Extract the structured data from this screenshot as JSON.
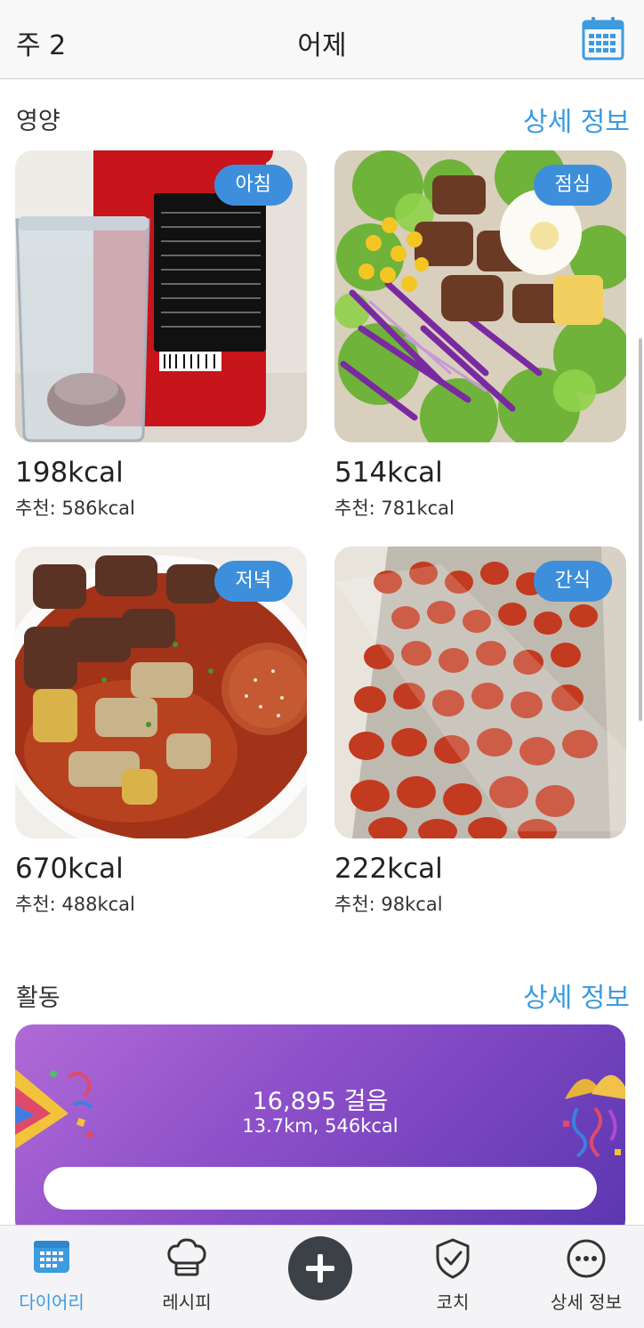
{
  "header": {
    "week_label": "주 2",
    "title": "어제",
    "calendar_icon": "calendar-icon"
  },
  "nutrition": {
    "title": "영양",
    "link": "상세 정보",
    "meals": [
      {
        "badge": "아침",
        "kcal": "198kcal",
        "recommended": "추천: 586kcal"
      },
      {
        "badge": "점심",
        "kcal": "514kcal",
        "recommended": "추천: 781kcal"
      },
      {
        "badge": "저녁",
        "kcal": "670kcal",
        "recommended": "추천: 488kcal"
      },
      {
        "badge": "간식",
        "kcal": "222kcal",
        "recommended": "추천: 98kcal"
      }
    ]
  },
  "activity": {
    "title": "활동",
    "link": "상세 정보",
    "steps": "16,895 걸음",
    "summary": "13.7km, 546kcal",
    "left_icon": "party-popper-icon",
    "right_icon": "confetti-ball-icon"
  },
  "tabbar": {
    "items": [
      {
        "label": "다이어리",
        "icon": "calendar-icon",
        "active": true
      },
      {
        "label": "레시피",
        "icon": "chef-hat-icon"
      },
      {
        "label": "",
        "icon": "plus-icon"
      },
      {
        "label": "코치",
        "icon": "shield-check-icon"
      },
      {
        "label": "상세 정보",
        "icon": "more-icon"
      }
    ]
  },
  "colors": {
    "accent": "#3d9be0",
    "badge": "#3d8fdc",
    "activity_gradient_start": "#b06ad6",
    "activity_gradient_end": "#5a36b0"
  }
}
